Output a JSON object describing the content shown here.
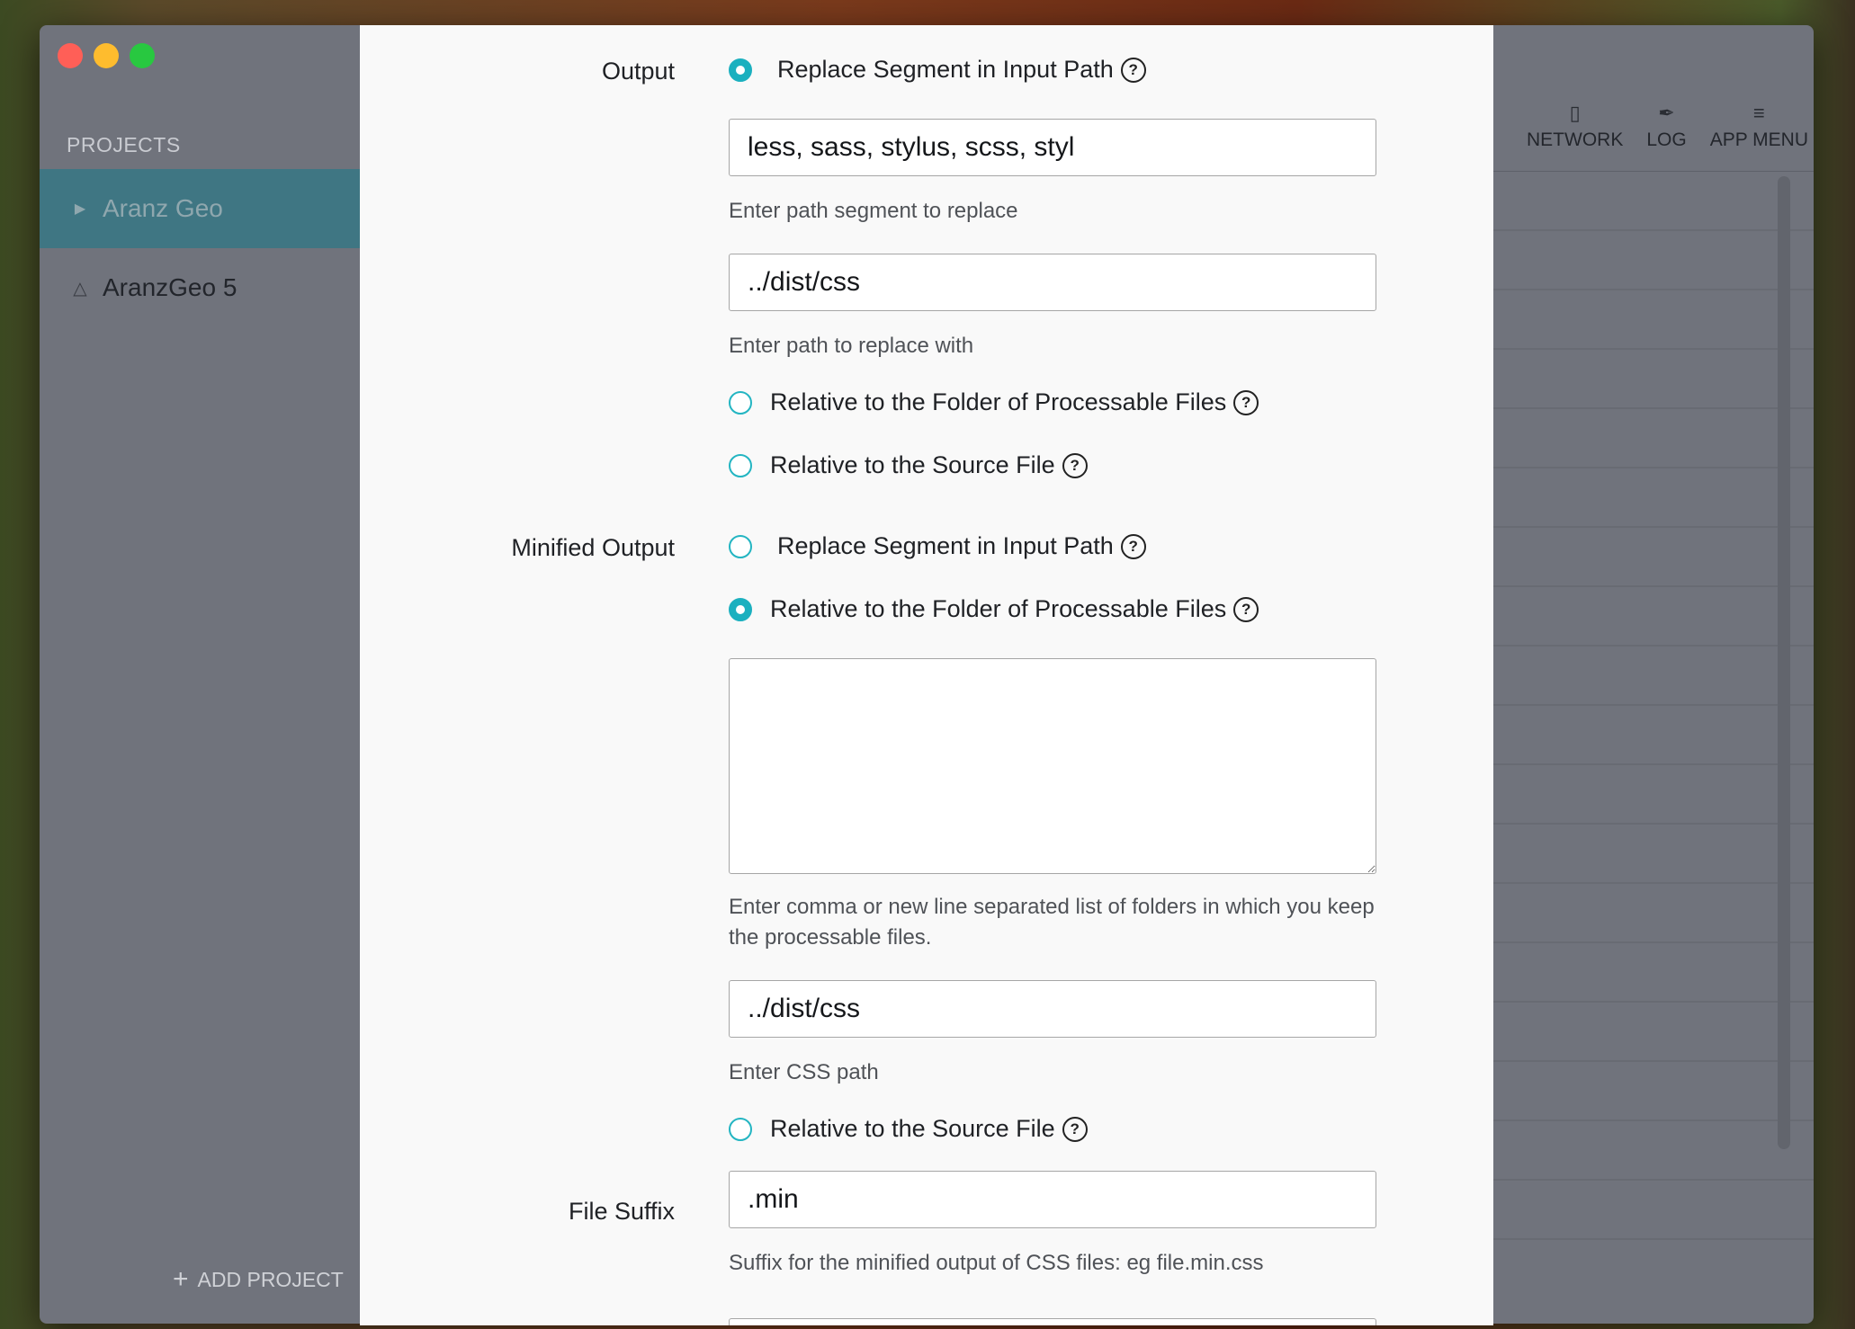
{
  "sidebar": {
    "heading": "PROJECTS",
    "projects": [
      {
        "label": "Aranz Geo",
        "icon": "triangle-right-icon",
        "active": true
      },
      {
        "label": "AranzGeo 5",
        "icon": "warning-icon",
        "active": false
      }
    ],
    "add_project": "ADD PROJECT"
  },
  "toolbar": {
    "network": "NETWORK",
    "log": "LOG",
    "app_menu": "APP MENU"
  },
  "form": {
    "output": {
      "label": "Output",
      "replace_segment": {
        "label": "Replace Segment in Input Path",
        "selected": true
      },
      "segment_value": "less, sass, stylus, scss, styl",
      "segment_hint": "Enter path segment to replace",
      "replace_with_value": "../dist/css",
      "replace_with_hint": "Enter path to replace with",
      "relative_folder": {
        "label": "Relative to the Folder of Processable Files",
        "selected": false
      },
      "relative_source": {
        "label": "Relative to the Source File",
        "selected": false
      }
    },
    "minified_output": {
      "label": "Minified Output",
      "replace_segment": {
        "label": "Replace Segment in Input Path",
        "selected": false
      },
      "relative_folder": {
        "label": "Relative to the Folder of Processable Files",
        "selected": true
      },
      "folders_value": "",
      "folders_hint": "Enter comma or new line separated list of folders in which you keep the processable files.",
      "css_path_value": "../dist/css",
      "css_path_hint": "Enter CSS path",
      "relative_source": {
        "label": "Relative to the Source File",
        "selected": false
      }
    },
    "file_suffix": {
      "label": "File Suffix",
      "value": ".min",
      "hint": "Suffix for the minified output of CSS files: eg file.min.css"
    }
  },
  "colors": {
    "accent": "#1bb0bf",
    "sidebar_active": "#3f7683",
    "window_bg": "#70737c"
  }
}
